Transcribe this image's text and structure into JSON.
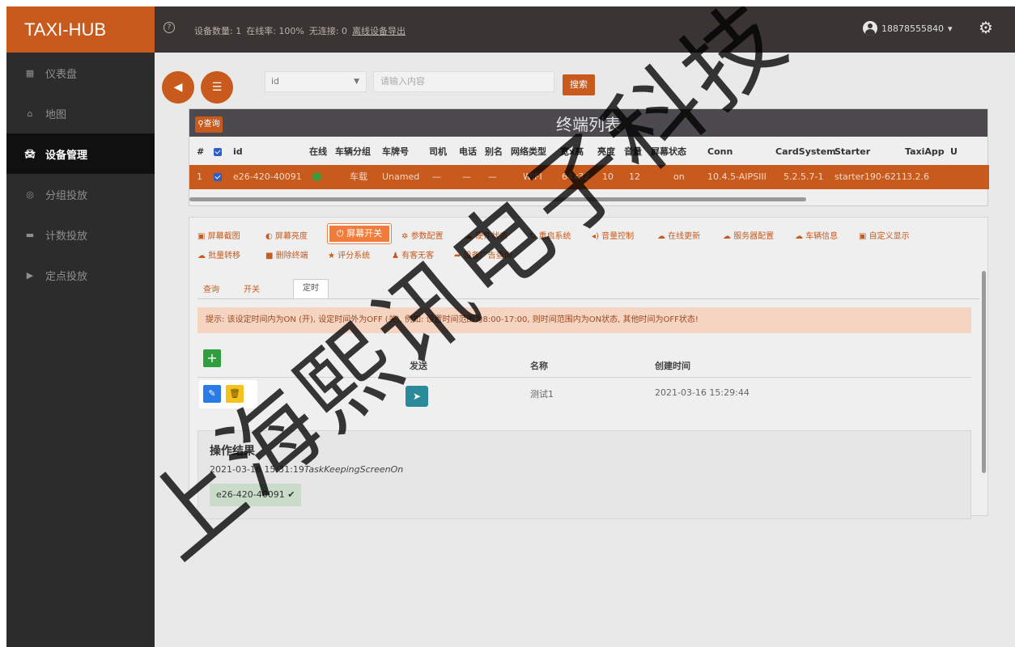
{
  "brand": "TAXI-HUB",
  "topbar": {
    "stats": [
      "设备数量: 1",
      "在线率: 100%",
      "无连接: 0"
    ],
    "export_label": "离线设备导出",
    "user": "18878555840"
  },
  "sidebar": {
    "items": [
      {
        "label": "仪表盘",
        "icon": "dashboard-icon",
        "active": false
      },
      {
        "label": "地图",
        "icon": "map-icon",
        "active": false
      },
      {
        "label": "设备管理",
        "icon": "car-icon",
        "active": true
      },
      {
        "label": "分组投放",
        "icon": "group-icon",
        "active": false
      },
      {
        "label": "计数投放",
        "icon": "count-icon",
        "active": false
      },
      {
        "label": "定点投放",
        "icon": "play-icon",
        "active": false
      }
    ]
  },
  "search": {
    "field_value": "id",
    "placeholder": "请输入内容",
    "button_label": "搜索"
  },
  "table": {
    "query_label": "查询",
    "title": "终端列表",
    "headers": [
      "#",
      "id",
      "在线",
      "车辆分组",
      "车牌号",
      "司机",
      "电话",
      "别名",
      "网络类型",
      "宽x高",
      "亮度",
      "音量",
      "屏幕状态",
      "Conn",
      "CardSystem",
      "Starter",
      "TaxiApp",
      "U"
    ],
    "row": {
      "index": "1",
      "id": "e26-420-40091",
      "group": "车载",
      "plate": "Unamed",
      "driver": "—",
      "phone": "—",
      "alias": "—",
      "network": "WIFI",
      "size": "64x32",
      "brightness": "10",
      "volume": "12",
      "screen": "on",
      "conn": "10.4.5-AIPSIII",
      "cardsystem": "5.2.5.7-1",
      "starter": "starter190-6211",
      "taxiapp": "3.2.6"
    }
  },
  "ops": {
    "row1": [
      "屏幕截图",
      "屏幕亮度",
      "屏幕开关",
      "参数配置",
      "硬件状态",
      "重启系统",
      "音量控制",
      "在线更新",
      "服务器配置",
      "车辆信息",
      "自定义显示"
    ],
    "row2": [
      "批量转移",
      "删除终端",
      "评分系统",
      "有客无客",
      "设备广告查询"
    ]
  },
  "subtabs": [
    "查询",
    "开关",
    "定时"
  ],
  "notice": "提示: 该设定时间内为ON (开), 设定时间外为OFF (关), 例如: 设置时间范围为8:00-17:00, 则时间范围内为ON状态, 其他时间为OFF状态!",
  "schedule": {
    "headers": {
      "send": "发送",
      "name": "名称",
      "created": "创建时间"
    },
    "rows": [
      {
        "name": "测试1",
        "created": "2021-03-16 15:29:44"
      }
    ]
  },
  "result": {
    "title": "操作结果",
    "timestamp": "2021-03-16 15:31:19",
    "task": "TaskKeepingScreenOn",
    "device": "e26-420-40091 ✔"
  },
  "watermark": "上海熙讯电子科技",
  "colors": {
    "accent": "#c85a1d",
    "sidebar": "#2c2c2c",
    "topbar": "#3a3432",
    "success": "#2e9e3e",
    "edit": "#2b7be6",
    "delete": "#f4c21a"
  }
}
